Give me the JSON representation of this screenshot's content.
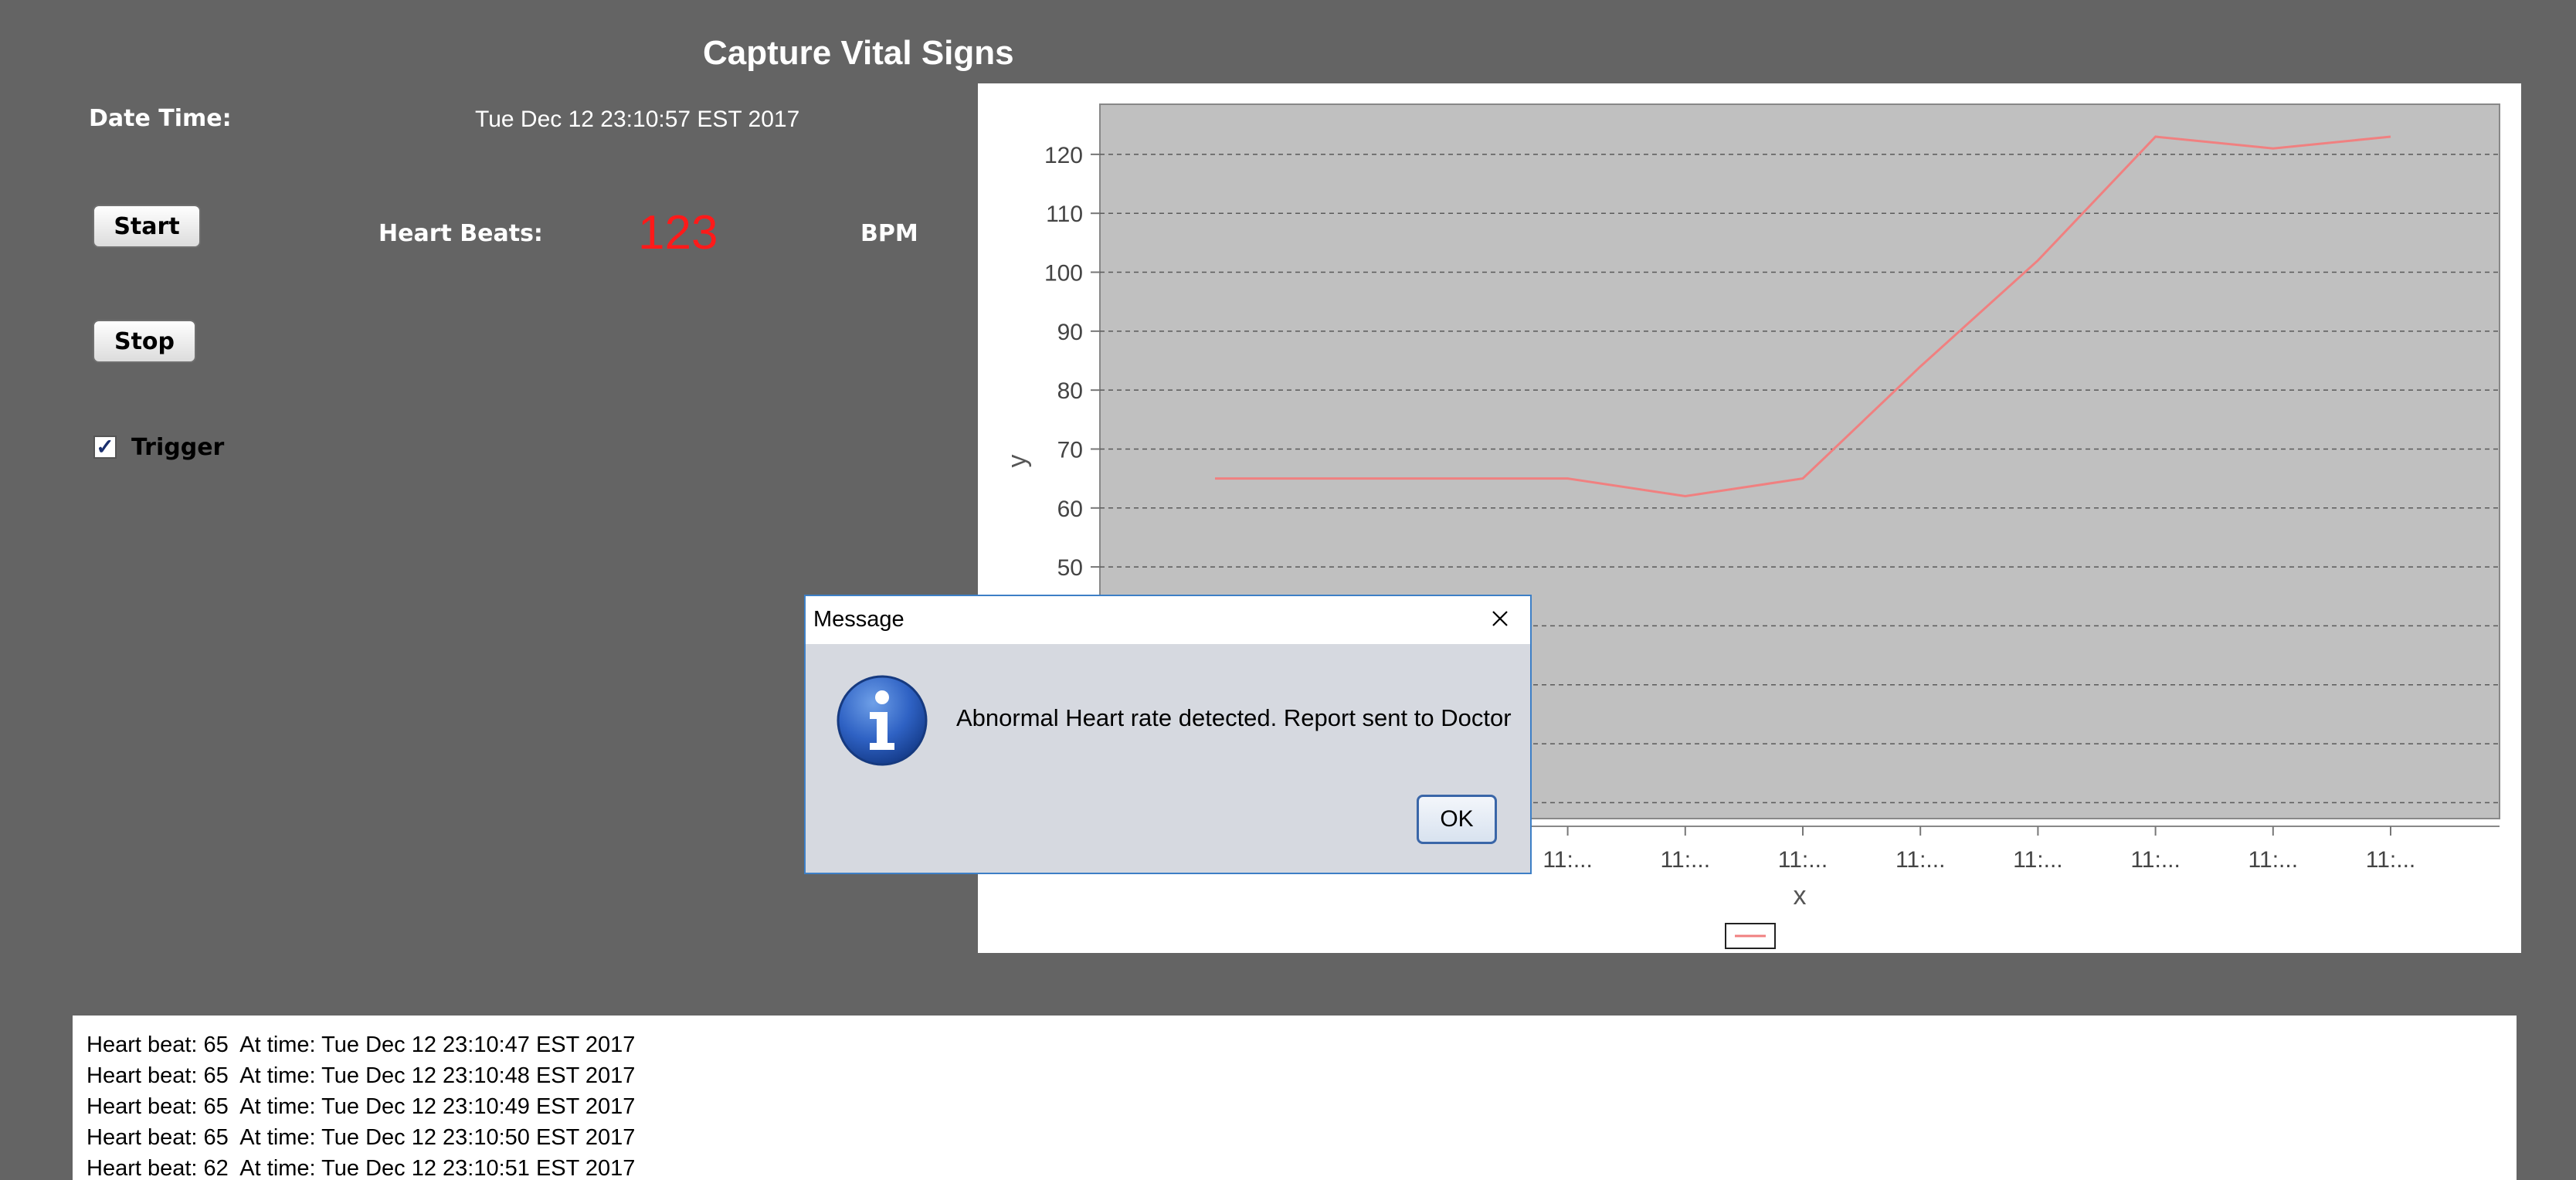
{
  "app": {
    "title": "Capture Vital Signs"
  },
  "controls": {
    "date_time_label": "Date Time:",
    "date_time_value": "Tue Dec 12 23:10:57 EST 2017",
    "start_label": "Start",
    "stop_label": "Stop",
    "heart_beats_label": "Heart Beats:",
    "heart_beats_value": "123",
    "unit_label": "BPM",
    "trigger_label": "Trigger",
    "trigger_checked": true,
    "trigger_check_glyph": "✓"
  },
  "chart_data": {
    "type": "line",
    "xlabel": "x",
    "ylabel": "y",
    "grid": true,
    "legend": "bottom-center",
    "line_color": "#f08080",
    "plot_background": "#c0c0c0",
    "y_ticks": [
      120,
      110,
      100,
      90,
      80,
      70,
      60,
      50
    ],
    "x_tick_label": "11:...",
    "visible_x_tick_count": 8,
    "series": [
      {
        "values": [
          65,
          65,
          65,
          65,
          62,
          65,
          84,
          102,
          123,
          121,
          123
        ]
      }
    ]
  },
  "dialog": {
    "title": "Message",
    "message": "Abnormal Heart rate detected. Report sent to Doctor",
    "ok_label": "OK",
    "icon": "info-icon"
  },
  "log": {
    "lines": [
      "Heart beat: 65  At time: Tue Dec 12 23:10:47 EST 2017",
      "Heart beat: 65  At time: Tue Dec 12 23:10:48 EST 2017",
      "Heart beat: 65  At time: Tue Dec 12 23:10:49 EST 2017",
      "Heart beat: 65  At time: Tue Dec 12 23:10:50 EST 2017",
      "Heart beat: 62  At time: Tue Dec 12 23:10:51 EST 2017"
    ]
  }
}
